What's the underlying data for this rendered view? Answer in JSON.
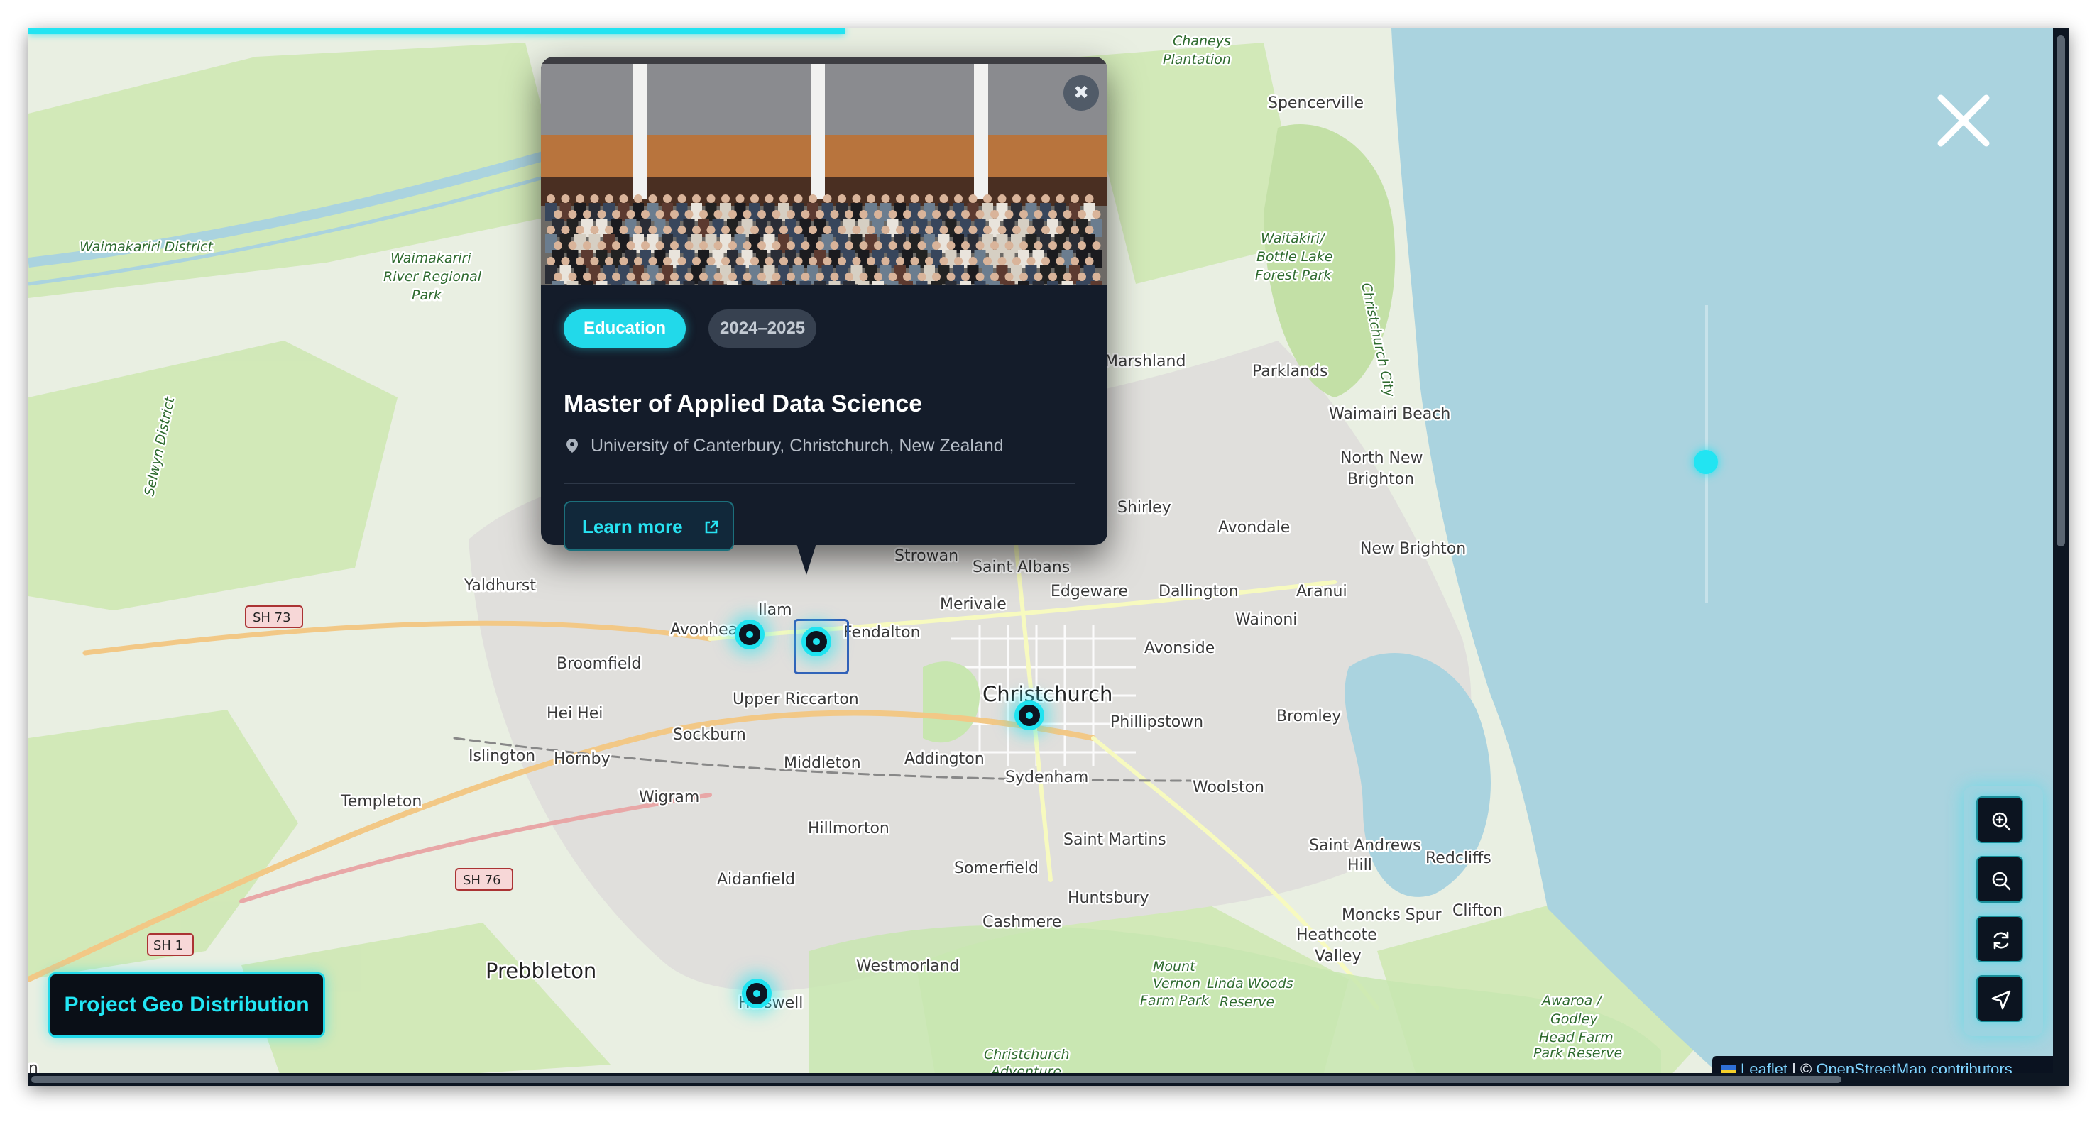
{
  "map": {
    "places": [
      {
        "name": "Christchurch",
        "size": "big"
      },
      {
        "name": "Prebbleton",
        "size": "big"
      },
      {
        "name": "Halswell",
        "size": "mid"
      },
      {
        "name": "Avonhead",
        "size": "mid"
      },
      {
        "name": "Ilam",
        "size": "mid"
      },
      {
        "name": "Fendalton",
        "size": "mid"
      },
      {
        "name": "Merivale",
        "size": "mid"
      },
      {
        "name": "Strowan",
        "size": "mid"
      },
      {
        "name": "Saint Albans",
        "size": "mid"
      },
      {
        "name": "Edgeware",
        "size": "mid"
      },
      {
        "name": "Dallington",
        "size": "mid"
      },
      {
        "name": "Wainoni",
        "size": "mid"
      },
      {
        "name": "Aranui",
        "size": "mid"
      },
      {
        "name": "Avonside",
        "size": "mid"
      },
      {
        "name": "Avondale",
        "size": "mid"
      },
      {
        "name": "Shirley",
        "size": "mid"
      },
      {
        "name": "Marshland",
        "size": "mid"
      },
      {
        "name": "Parklands",
        "size": "mid"
      },
      {
        "name": "Spencerville",
        "size": "mid"
      },
      {
        "name": "Waimairi Beach",
        "size": "mid"
      },
      {
        "name": "North New",
        "size": "mid"
      },
      {
        "name": "Brighton",
        "size": "mid"
      },
      {
        "name": "New Brighton",
        "size": "mid"
      },
      {
        "name": "Bromley",
        "size": "mid"
      },
      {
        "name": "Phillipstown",
        "size": "mid"
      },
      {
        "name": "Woolston",
        "size": "mid"
      },
      {
        "name": "Sydenham",
        "size": "mid"
      },
      {
        "name": "Addington",
        "size": "mid"
      },
      {
        "name": "Middleton",
        "size": "mid"
      },
      {
        "name": "Sockburn",
        "size": "mid"
      },
      {
        "name": "Upper Riccarton",
        "size": "mid"
      },
      {
        "name": "Broomfield",
        "size": "mid"
      },
      {
        "name": "Yaldhurst",
        "size": "mid"
      },
      {
        "name": "Hei Hei",
        "size": "mid"
      },
      {
        "name": "Islington",
        "size": "mid"
      },
      {
        "name": "Hornby",
        "size": "mid"
      },
      {
        "name": "Templeton",
        "size": "mid"
      },
      {
        "name": "Wigram",
        "size": "mid"
      },
      {
        "name": "Hillmorton",
        "size": "mid"
      },
      {
        "name": "Aidanfield",
        "size": "mid"
      },
      {
        "name": "Somerfield",
        "size": "mid"
      },
      {
        "name": "Saint Martins",
        "size": "mid"
      },
      {
        "name": "Huntsbury",
        "size": "mid"
      },
      {
        "name": "Cashmere",
        "size": "mid"
      },
      {
        "name": "Westmorland",
        "size": "mid"
      },
      {
        "name": "Saint Andrews",
        "size": "mid"
      },
      {
        "name": "Hill",
        "size": "mid"
      },
      {
        "name": "Redcliffs",
        "size": "mid"
      },
      {
        "name": "Moncks Spur",
        "size": "mid"
      },
      {
        "name": "Clifton",
        "size": "mid"
      },
      {
        "name": "Heathcote",
        "size": "mid"
      },
      {
        "name": "Valley",
        "size": "mid"
      },
      {
        "name": "Chaneys",
        "size": "park"
      },
      {
        "name": "Plantation",
        "size": "park"
      },
      {
        "name": "Waimakariri District",
        "size": "park"
      },
      {
        "name": "Waimakariri",
        "size": "park"
      },
      {
        "name": "River Regional",
        "size": "park"
      },
      {
        "name": "Park",
        "size": "park"
      },
      {
        "name": "Selwyn District",
        "size": "park"
      },
      {
        "name": "Waitākiri/",
        "size": "park"
      },
      {
        "name": "Bottle Lake",
        "size": "park"
      },
      {
        "name": "Forest Park",
        "size": "park"
      },
      {
        "name": "Christchurch City",
        "size": "park"
      },
      {
        "name": "Mount",
        "size": "park"
      },
      {
        "name": "Vernon",
        "size": "park"
      },
      {
        "name": "Farm Park",
        "size": "park"
      },
      {
        "name": "Linda Woods",
        "size": "park"
      },
      {
        "name": "Reserve",
        "size": "park"
      },
      {
        "name": "Awaroa /",
        "size": "park"
      },
      {
        "name": "Godley",
        "size": "park"
      },
      {
        "name": "Head Farm",
        "size": "park"
      },
      {
        "name": "Park Reserve",
        "size": "park"
      },
      {
        "name": "Christchurch",
        "size": "park"
      },
      {
        "name": "Adventure",
        "size": "park"
      }
    ],
    "shields": [
      "SH 73",
      "SH 76",
      "SH 1"
    ],
    "edge_text": "n",
    "colors": {
      "sea": "#aad3df",
      "land": "#e9efe2",
      "park": "#c8e6b0",
      "urban": "#e0dfdc",
      "accent": "#22e4f2"
    }
  },
  "popup": {
    "category": "Education",
    "years": "2024–2025",
    "title": "Master of Applied Data Science",
    "location": "University of Canterbury, Christchurch, New Zealand",
    "learn_more": "Learn more",
    "close_glyph": "✖",
    "photo_icon": "group-photo"
  },
  "geo_button": "Project Geo Distribution",
  "attribution": {
    "leaflet": "Leaflet",
    "separator": " | © ",
    "osm": "OpenStreetMap contributors"
  },
  "controls": {
    "zoom_in_icon": "zoom-in-icon",
    "zoom_out_icon": "zoom-out-icon",
    "reset_icon": "refresh-icon",
    "locate_icon": "navigate-icon"
  },
  "progress": 0.4
}
